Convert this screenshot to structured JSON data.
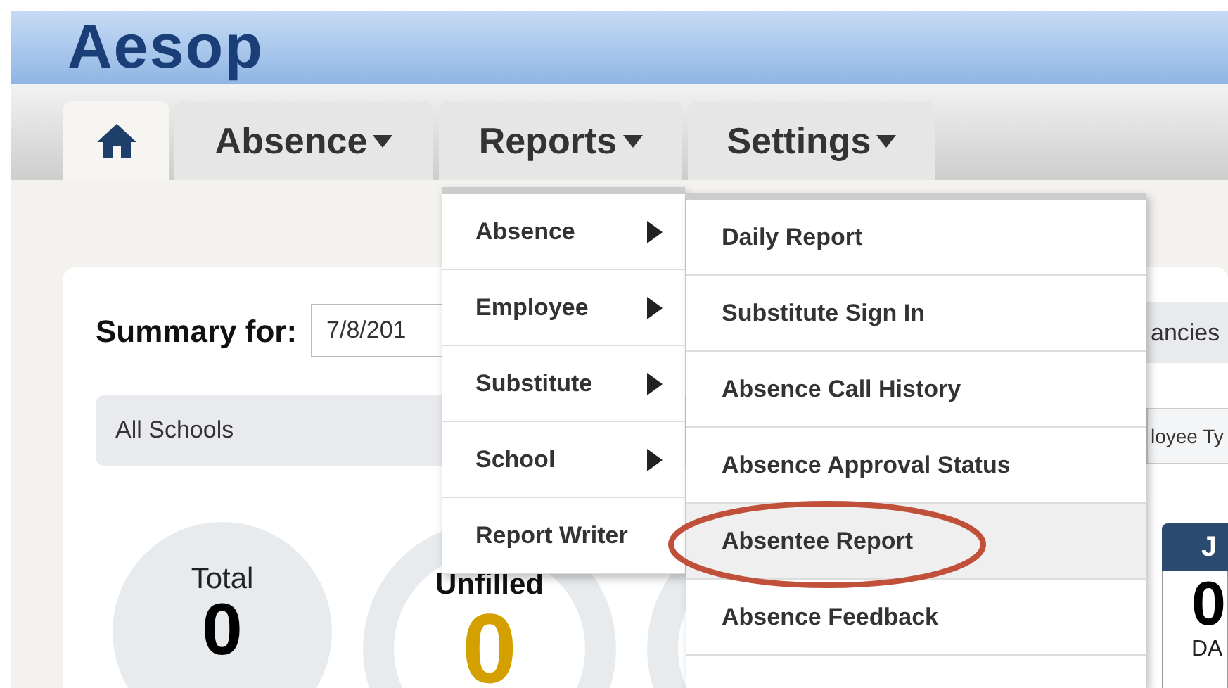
{
  "logo": {
    "text": "Aesop"
  },
  "tabs": [
    {
      "kind": "home",
      "selected": true
    },
    {
      "kind": "text",
      "label": "Absence",
      "selected": false
    },
    {
      "kind": "text",
      "label": "Reports",
      "selected": false
    },
    {
      "kind": "text",
      "label": "Settings",
      "selected": false
    }
  ],
  "summary": {
    "label": "Summary for:",
    "date": "7/8/201"
  },
  "school_filter": {
    "value": "All Schools"
  },
  "right_panel": {
    "tab_text": "ancies",
    "field_text": "loyee Ty"
  },
  "stats": [
    {
      "kind": "filled",
      "label": "Total",
      "value": "0"
    },
    {
      "kind": "ring",
      "label": "Unfilled",
      "value": "0"
    },
    {
      "kind": "ring"
    }
  ],
  "day_card": {
    "header": "J",
    "value": "0",
    "caption": "DA"
  },
  "reports_menu": [
    {
      "label": "Absence",
      "has_submenu": true
    },
    {
      "label": "Employee",
      "has_submenu": true
    },
    {
      "label": "Substitute",
      "has_submenu": true
    },
    {
      "label": "School",
      "has_submenu": true
    },
    {
      "label": "Report Writer",
      "has_submenu": false
    }
  ],
  "submenu": [
    {
      "label": "Daily Report",
      "selected": false
    },
    {
      "label": "Substitute Sign In",
      "selected": false
    },
    {
      "label": "Absence Call History",
      "selected": false
    },
    {
      "label": "Absence Approval Status",
      "selected": false
    },
    {
      "label": "Absentee Report",
      "selected": true
    },
    {
      "label": "Absence Feedback",
      "selected": false
    }
  ],
  "annotation": {
    "kind": "ellipse"
  }
}
